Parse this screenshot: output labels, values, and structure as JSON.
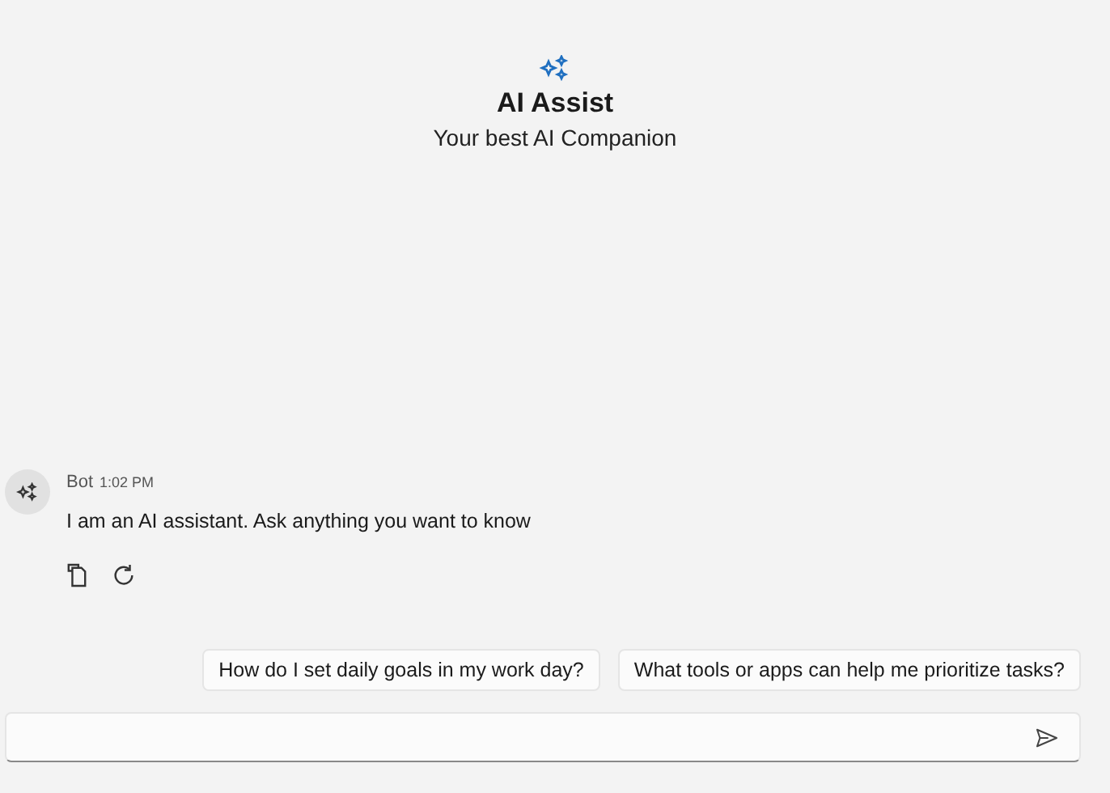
{
  "header": {
    "title": "AI Assist",
    "subtitle": "Your best AI Companion"
  },
  "messages": [
    {
      "sender": "Bot",
      "time": "1:02 PM",
      "text": "I am an AI assistant. Ask anything you want to know"
    }
  ],
  "suggestions": [
    "How do I set daily goals in my work day?",
    "What tools or apps can help me prioritize tasks?"
  ]
}
